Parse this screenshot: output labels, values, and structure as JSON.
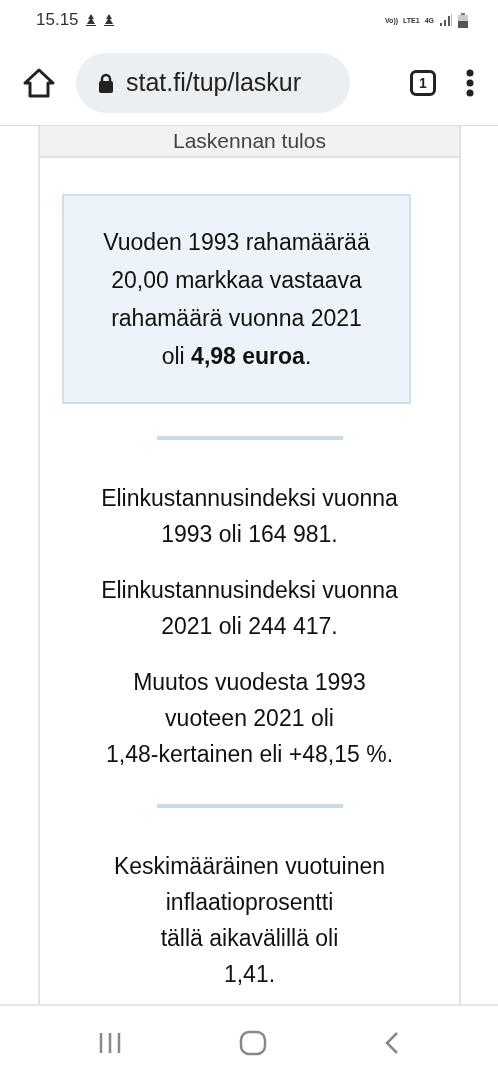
{
  "status_bar": {
    "time": "15.15",
    "network": [
      "Vo))",
      "LTE1",
      "4G"
    ]
  },
  "browser": {
    "url": "stat.fi/tup/laskur",
    "tab_count": "1"
  },
  "card": {
    "title": "Laskennan tulos",
    "result": {
      "lines": [
        "Vuoden 1993 rahamäärää",
        "20,00 markkaa vastaava",
        "rahamäärä vuonna 2021",
        "oli **4,98 euroa**."
      ]
    },
    "sections": [
      {
        "paragraphs": [
          {
            "lines": [
              "Elinkustannusindeksi vuonna",
              "1993 oli 164 981."
            ]
          },
          {
            "lines": [
              "Elinkustannusindeksi vuonna",
              "2021 oli 244 417."
            ]
          },
          {
            "lines": [
              "Muutos vuodesta 1993",
              "vuoteen 2021 oli",
              "1,48-kertainen eli +48,15 %."
            ]
          }
        ]
      },
      {
        "paragraphs": [
          {
            "lines": [
              "Keskimääräinen vuotuinen",
              "inflaatioprosentti",
              "tällä aikavälillä oli",
              "1,41."
            ]
          }
        ]
      }
    ]
  }
}
